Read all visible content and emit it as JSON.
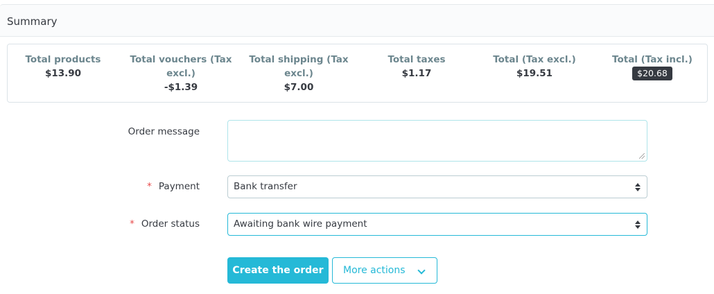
{
  "panel": {
    "title": "Summary"
  },
  "summary": {
    "total_products": {
      "label": "Total products",
      "value": "$13.90"
    },
    "total_vouchers": {
      "label_line1": "Total vouchers (Tax",
      "label_line2": "excl.)",
      "value": "-$1.39"
    },
    "total_shipping": {
      "label_line1": "Total shipping (Tax",
      "label_line2": "excl.)",
      "value": "$7.00"
    },
    "total_taxes": {
      "label": "Total taxes",
      "value": "$1.17"
    },
    "total_tax_excl": {
      "label": "Total (Tax excl.)",
      "value": "$19.51"
    },
    "total_tax_incl": {
      "label": "Total (Tax incl.)",
      "value": "$20.68"
    }
  },
  "form": {
    "order_message": {
      "label": "Order message",
      "value": ""
    },
    "payment": {
      "label": "Payment",
      "required_mark": "*",
      "value": "Bank transfer"
    },
    "order_status": {
      "label": "Order status",
      "required_mark": "*",
      "value": "Awaiting bank wire payment"
    }
  },
  "actions": {
    "create_label": "Create the order",
    "more_label": "More actions"
  },
  "colors": {
    "accent": "#25b9d7",
    "required": "#e84b4b",
    "badge_bg": "#363a41"
  },
  "icons": {
    "select_arrows": "sort-arrows-icon",
    "more_actions": "chevron-down-icon"
  }
}
